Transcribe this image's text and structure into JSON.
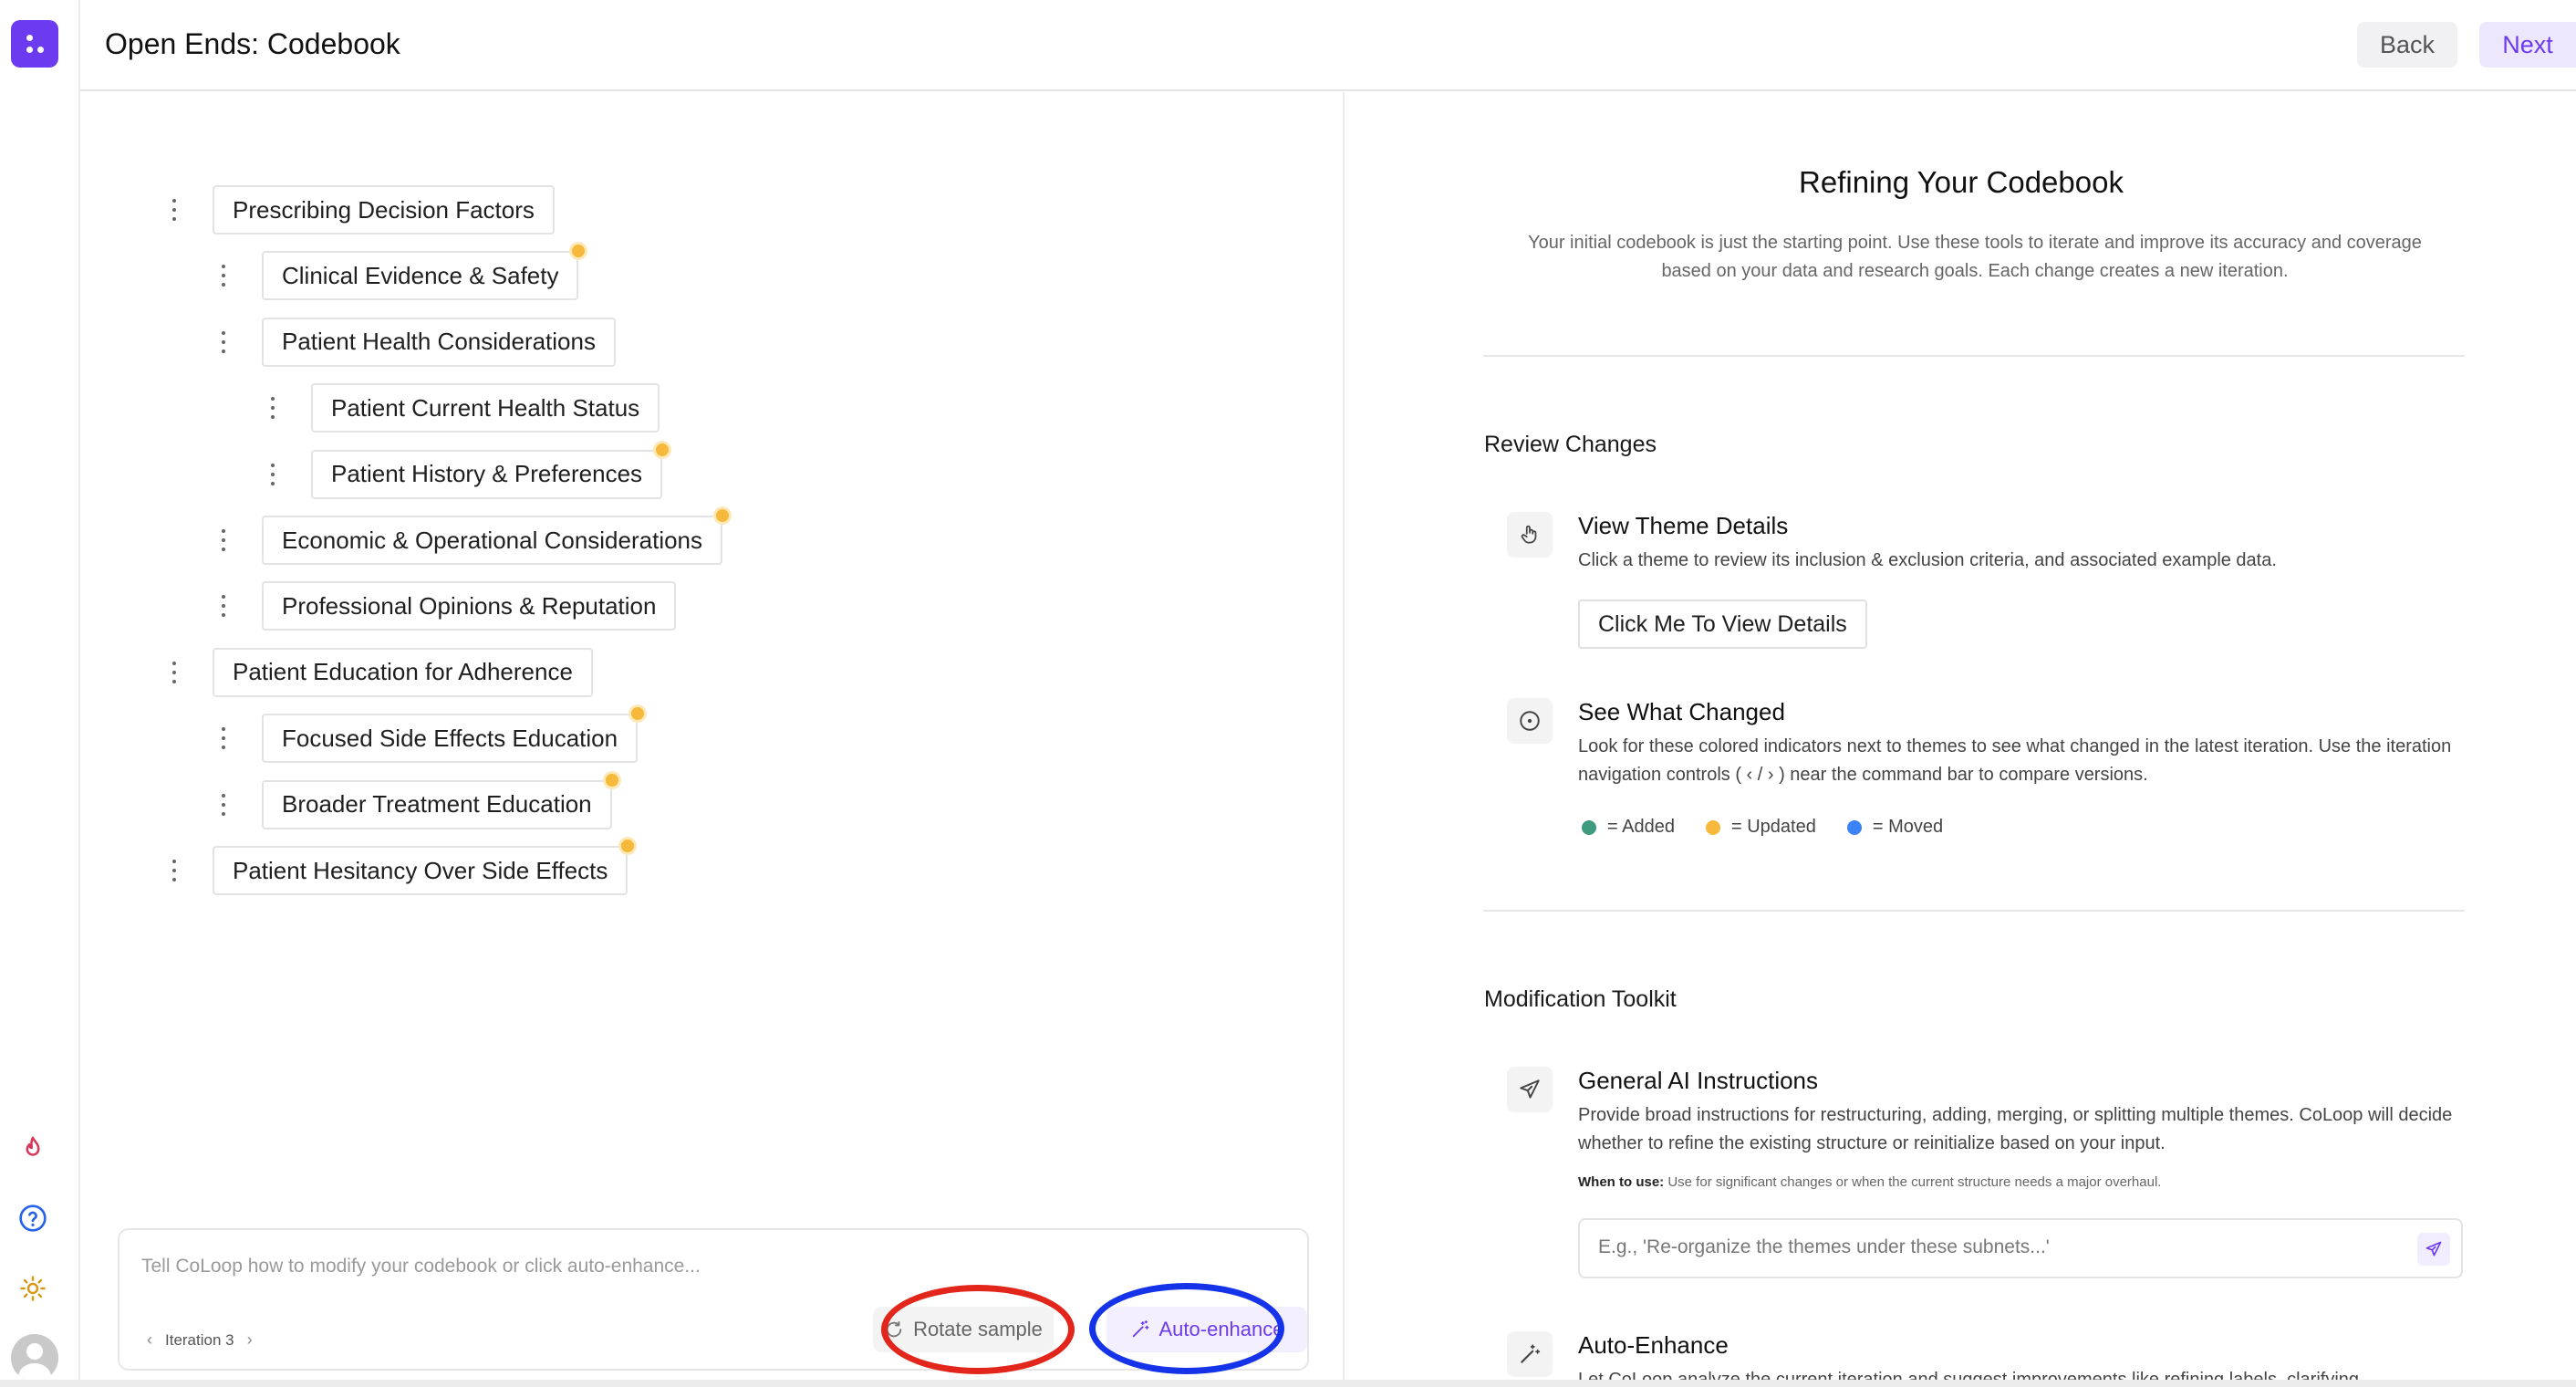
{
  "header": {
    "title": "Open Ends: Codebook",
    "back_label": "Back",
    "next_label": "Next"
  },
  "rail": {
    "icons": [
      "logo-icon",
      "flame-icon",
      "help-icon",
      "sun-icon",
      "avatar"
    ]
  },
  "tree": [
    {
      "label": "Prescribing Decision Factors",
      "level": 0,
      "status": "none"
    },
    {
      "label": "Clinical Evidence & Safety",
      "level": 1,
      "status": "updated"
    },
    {
      "label": "Patient Health Considerations",
      "level": 1,
      "status": "none"
    },
    {
      "label": "Patient Current Health Status",
      "level": 2,
      "status": "none"
    },
    {
      "label": "Patient History & Preferences",
      "level": 2,
      "status": "updated"
    },
    {
      "label": "Economic & Operational Considerations",
      "level": 1,
      "status": "updated"
    },
    {
      "label": "Professional Opinions & Reputation",
      "level": 1,
      "status": "none"
    },
    {
      "label": "Patient Education for Adherence",
      "level": 0,
      "status": "none"
    },
    {
      "label": "Focused Side Effects Education",
      "level": 1,
      "status": "updated"
    },
    {
      "label": "Broader Treatment Education",
      "level": 1,
      "status": "updated"
    },
    {
      "label": "Patient Hesitancy Over Side Effects",
      "level": 0,
      "status": "updated"
    }
  ],
  "command_bar": {
    "placeholder": "Tell CoLoop how to modify your codebook or click auto-enhance...",
    "iteration_label": "Iteration 3",
    "rotate_label": "Rotate sample",
    "enhance_label": "Auto-enhance"
  },
  "right": {
    "title": "Refining Your Codebook",
    "subtitle": "Your initial codebook is just the starting point. Use these tools to iterate and improve its accuracy and coverage based on your data and research goals. Each change creates a new iteration.",
    "review_title": "Review Changes",
    "view_details": {
      "title": "View Theme Details",
      "desc": "Click a theme to review its inclusion & exclusion criteria, and associated example data.",
      "button": "Click Me To View Details"
    },
    "what_changed": {
      "title": "See What Changed",
      "desc": "Look for these colored indicators next to themes to see what changed in the latest iteration. Use the iteration navigation controls ( ‹ / › ) near the command bar to compare versions.",
      "legend": [
        {
          "label": "= Added",
          "color": "#3f9b7f"
        },
        {
          "label": "= Updated",
          "color": "#f6b93b"
        },
        {
          "label": "= Moved",
          "color": "#3b82f6"
        }
      ]
    },
    "toolkit_title": "Modification Toolkit",
    "general_ai": {
      "title": "General AI Instructions",
      "desc": "Provide broad instructions for restructuring, adding, merging, or splitting multiple themes. CoLoop will decide whether to refine the existing structure or reinitialize based on your input.",
      "when_label": "When to use:",
      "when_text": "Use for significant changes or when the current structure needs a major overhaul.",
      "placeholder": "E.g., 'Re-organize the themes under these subnets...'"
    },
    "auto_enhance": {
      "title": "Auto-Enhance",
      "desc": "Let CoLoop analyze the current iteration and suggest improvements like refining labels, clarifying"
    }
  },
  "colors": {
    "accent": "#6c3bf0",
    "updated": "#f6b93b",
    "annotation_red": "#e2261c",
    "annotation_blue": "#1533e8"
  }
}
